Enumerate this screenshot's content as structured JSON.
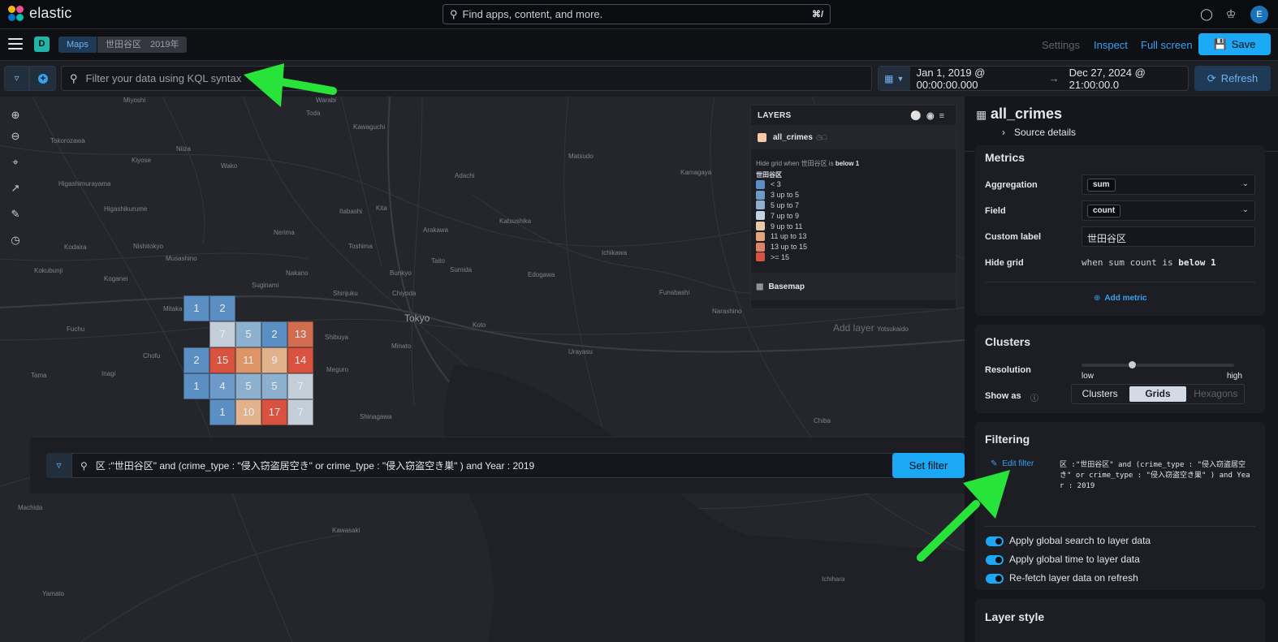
{
  "header": {
    "brand": "elastic",
    "search_placeholder": "Find apps, content, and more.",
    "search_shortcut": "⌘/",
    "avatar_initial": "E"
  },
  "appbar": {
    "space_initial": "D",
    "breadcrumb_app": "Maps",
    "breadcrumb_current": "世田谷区　2019年",
    "settings_label": "Settings",
    "inspect_label": "Inspect",
    "fullscreen_label": "Full screen",
    "save_label": "Save"
  },
  "query": {
    "kql_placeholder": "Filter your data using KQL syntax",
    "date_start": "Jan 1, 2019 @ 00:00:00.000",
    "date_end": "Dec 27, 2024 @ 21:00:00.0",
    "refresh_label": "Refresh"
  },
  "map": {
    "place_labels": [
      "Miyoshi",
      "Kiyose",
      "Tokorozawa",
      "Higashimurayama",
      "Higashikurume",
      "Kodaira",
      "Nishitokyo",
      "Musashino",
      "Koganei",
      "Kokubunji",
      "Fuchu",
      "Tama",
      "Inagi",
      "Chofu",
      "Mitaka",
      "Suginami",
      "Nakano",
      "Shinjuku",
      "Shibuya",
      "Meguro",
      "Shinagawa",
      "Minato",
      "Chiyoda",
      "Bunkyo",
      "Taito",
      "Sumida",
      "Koto",
      "Edogawa",
      "Katsushika",
      "Adachi",
      "Kita",
      "Itabashi",
      "Nerima",
      "Toshima",
      "Arakawa",
      "Toda",
      "Wako",
      "Niiza",
      "Kawaguchi",
      "Warabi",
      "Matsudo",
      "Ichikawa",
      "Funabashi",
      "Narashino",
      "Kamagaya",
      "Urayasu",
      "Machida",
      "Kawasaki",
      "Yamato",
      "Chiba",
      "Ichihara",
      "Yotsukaido"
    ],
    "tokyo_label": "Tokyo",
    "add_layer_hint": "Add layer",
    "grid_cells": [
      {
        "v": "1",
        "c": "#5b8fc3"
      },
      {
        "v": "2",
        "c": "#5b8fc3"
      },
      {
        "v": "7",
        "c": "#c3ced9"
      },
      {
        "v": "5",
        "c": "#8eb0cf"
      },
      {
        "v": "2",
        "c": "#5b8fc3"
      },
      {
        "v": "13",
        "c": "#d16c4f"
      },
      {
        "v": "2",
        "c": "#5b8fc3"
      },
      {
        "v": "15",
        "c": "#d8523f"
      },
      {
        "v": "11",
        "c": "#dd9467"
      },
      {
        "v": "9",
        "c": "#e1b28b"
      },
      {
        "v": "14",
        "c": "#d8523f"
      },
      {
        "v": "1",
        "c": "#5b8fc3"
      },
      {
        "v": "4",
        "c": "#6d9ac8"
      },
      {
        "v": "5",
        "c": "#8eb0cf"
      },
      {
        "v": "5",
        "c": "#8eb0cf"
      },
      {
        "v": "7",
        "c": "#c3ced9"
      },
      {
        "v": "1",
        "c": "#5b8fc3"
      },
      {
        "v": "10",
        "c": "#e1b28b"
      },
      {
        "v": "17",
        "c": "#d8523f"
      },
      {
        "v": "7",
        "c": "#c3ced9"
      }
    ]
  },
  "layers": {
    "title": "LAYERS",
    "layer_name": "all_crimes",
    "layer_color": "#f6c9a8",
    "hide_note_prefix": "Hide grid when 世田谷区 is ",
    "hide_note_bold": "below 1",
    "legend_title": "世田谷区",
    "legend": [
      {
        "label": "< 3",
        "color": "#5b8fc3"
      },
      {
        "label": "3 up to 5",
        "color": "#6d9ac8"
      },
      {
        "label": "5 up to 7",
        "color": "#8eb0cf"
      },
      {
        "label": "7 up to 9",
        "color": "#c3d3e2"
      },
      {
        "label": "9 up to 11",
        "color": "#ecc8a5"
      },
      {
        "label": "11 up to 13",
        "color": "#e4a47c"
      },
      {
        "label": "13 up to 15",
        "color": "#dc8466"
      },
      {
        "label": ">= 15",
        "color": "#d8523f"
      }
    ],
    "basemap_label": "Basemap"
  },
  "overlay": {
    "query_text": "区 :\"世田谷区\" and (crime_type : \"侵入窃盗居空き\" or crime_type : \"侵入窃盗空き巣\" ) and Year : 2019",
    "set_filter_label": "Set filter"
  },
  "panel": {
    "title": "all_crimes",
    "source_details": "Source details",
    "metrics": {
      "heading": "Metrics",
      "aggregation_label": "Aggregation",
      "aggregation_value": "sum",
      "field_label": "Field",
      "field_value": "count",
      "custom_label_label": "Custom label",
      "custom_label_value": "世田谷区",
      "hide_grid_label": "Hide grid",
      "hide_grid_text": "when sum count is ",
      "hide_grid_bold": "below 1",
      "add_metric": "Add metric"
    },
    "clusters": {
      "heading": "Clusters",
      "resolution_label": "Resolution",
      "low": "low",
      "high": "high",
      "resolution_level": 0.33,
      "show_as_label": "Show as",
      "options": [
        "Clusters",
        "Grids",
        "Hexagons"
      ],
      "selected": "Grids"
    },
    "filtering": {
      "heading": "Filtering",
      "edit_filter": "Edit filter",
      "filter_text": "区 :\"世田谷区\" and (crime_type : \"侵入窃盗居空き\" or crime_type : \"侵入窃盗空き巣\" ) and Year : 2019",
      "toggles": [
        "Apply global search to layer data",
        "Apply global time to layer data",
        "Re-fetch layer data on refresh"
      ]
    },
    "layer_style": {
      "heading": "Layer style"
    }
  },
  "colors": {
    "accent": "#1ba9f5",
    "annotation_arrow": "#27e33a"
  }
}
